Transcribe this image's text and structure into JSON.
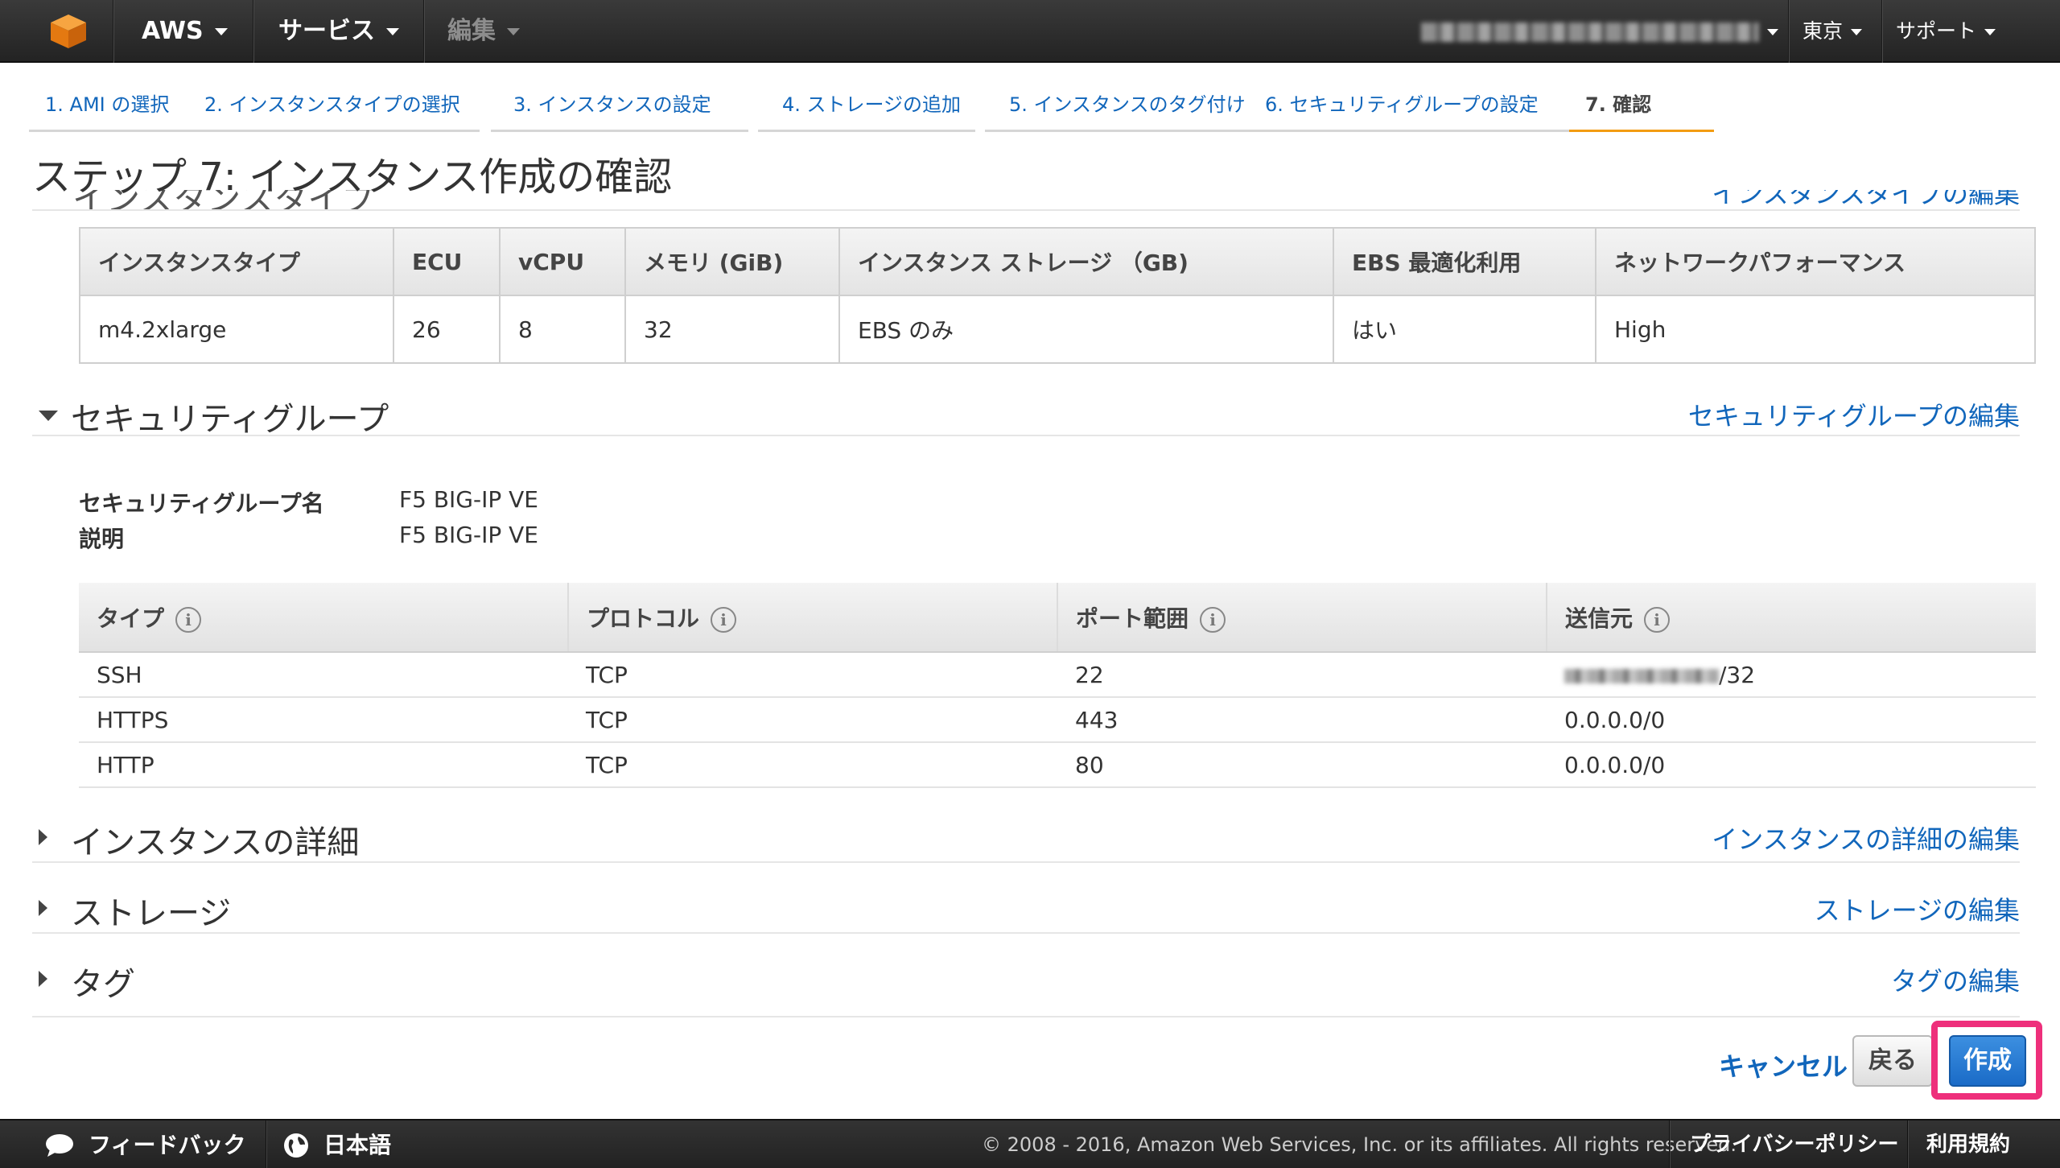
{
  "topbar": {
    "brand": "AWS",
    "services": "サービス",
    "edit": "編集",
    "region": "東京",
    "support": "サポート"
  },
  "tabs": [
    {
      "label": "1. AMI の選択"
    },
    {
      "label": "2. インスタンスタイプの選択"
    },
    {
      "label": "3. インスタンスの設定"
    },
    {
      "label": "4. ストレージの追加"
    },
    {
      "label": "5. インスタンスのタグ付け"
    },
    {
      "label": "6. セキュリティグループの設定"
    },
    {
      "label": "7. 確認"
    }
  ],
  "page": {
    "title": "ステップ 7: インスタンス作成の確認",
    "partial_section_title": "インスタンスタイプ",
    "partial_section_edit": "インスタンスタイプの編集"
  },
  "instance_table": {
    "headers": [
      "インスタンスタイプ",
      "ECU",
      "vCPU",
      "メモリ (GiB)",
      "インスタンス ストレージ （GB)",
      "EBS 最適化利用",
      "ネットワークパフォーマンス"
    ],
    "row": [
      "m4.2xlarge",
      "26",
      "8",
      "32",
      "EBS のみ",
      "はい",
      "High"
    ]
  },
  "security": {
    "title": "セキュリティグループ",
    "edit": "セキュリティグループの編集",
    "name_label": "セキュリティグループ名",
    "name_value": "F5 BIG-IP VE",
    "desc_label": "説明",
    "desc_value": "F5 BIG-IP VE",
    "headers": [
      "タイプ",
      "プロトコル",
      "ポート範囲",
      "送信元"
    ],
    "rows": [
      [
        "SSH",
        "TCP",
        "22",
        "/32"
      ],
      [
        "HTTPS",
        "TCP",
        "443",
        "0.0.0.0/0"
      ],
      [
        "HTTP",
        "TCP",
        "80",
        "0.0.0.0/0"
      ]
    ]
  },
  "sections": {
    "details_title": "インスタンスの詳細",
    "details_edit": "インスタンスの詳細の編集",
    "storage_title": "ストレージ",
    "storage_edit": "ストレージの編集",
    "tags_title": "タグ",
    "tags_edit": "タグの編集"
  },
  "actions": {
    "cancel": "キャンセル",
    "back": "戻る",
    "create": "作成"
  },
  "footer": {
    "feedback": "フィードバック",
    "language": "日本語",
    "copyright": "© 2008 - 2016, Amazon Web Services, Inc. or its affiliates. All rights reserved.",
    "privacy": "プライバシーポリシー",
    "terms": "利用規約"
  },
  "colors": {
    "link": "#1166bb",
    "active_tab": "#f39c12",
    "primary_button": "#1a6bc7",
    "highlight": "#ee2f7b"
  }
}
